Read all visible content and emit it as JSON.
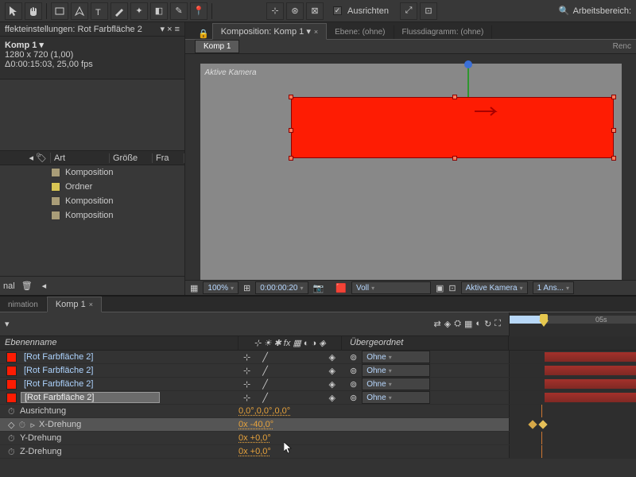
{
  "toolbar": {
    "align_label": "Ausrichten",
    "workspace_label": "Arbeitsbereich:"
  },
  "effects": {
    "header": "ffekteinstellungen: Rot Farbfläche 2",
    "comp_title": "Komp 1 ▾",
    "comp_dims": "1280 x 720 (1,00)",
    "comp_dur": "Δ0:00:15:03, 25,00 fps"
  },
  "project": {
    "cols": {
      "art": "Art",
      "groesse": "Größe",
      "fra": "Fra"
    },
    "items": [
      {
        "label": "Komposition",
        "swatch": "#a99d78"
      },
      {
        "label": "Ordner",
        "swatch": "#d9c654"
      },
      {
        "label": "Komposition",
        "swatch": "#a99d78"
      },
      {
        "label": "Komposition",
        "swatch": "#a99d78"
      }
    ],
    "footer_label": "nal"
  },
  "viewport": {
    "tab_comp": "Komposition: Komp 1 ▾",
    "tab_layer": "Ebene: (ohne)",
    "tab_flow": "Flussdiagramm: (ohne)",
    "subtab": "Komp 1",
    "render": "Renc",
    "camera_label": "Aktive Kamera"
  },
  "footer": {
    "zoom": "100%",
    "time": "0:00:00:20",
    "quality": "Voll",
    "view": "Aktive Kamera",
    "views": "1 Ans..."
  },
  "timeline": {
    "tab_anim": "nimation",
    "tab_comp": "Komp 1",
    "ruler_05": "05s",
    "col_name": "Ebenenname",
    "col_parent": "Übergeordnet",
    "layers": [
      {
        "name": "[Rot Farbfläche 2]"
      },
      {
        "name": "[Rot Farbfläche 2]"
      },
      {
        "name": "[Rot Farbfläche 2]"
      },
      {
        "name": "[Rot Farbfläche 2]"
      }
    ],
    "parent_value": "Ohne",
    "props": {
      "ausrichtung": {
        "label": "Ausrichtung",
        "value": "0,0°,0,0°,0,0°"
      },
      "xdreh": {
        "label": "X-Drehung",
        "value": "0x -40,0°"
      },
      "ydreh": {
        "label": "Y-Drehung",
        "value": "0x +0,0°"
      },
      "zdreh": {
        "label": "Z-Drehung",
        "value": "0x +0,0°"
      }
    }
  }
}
